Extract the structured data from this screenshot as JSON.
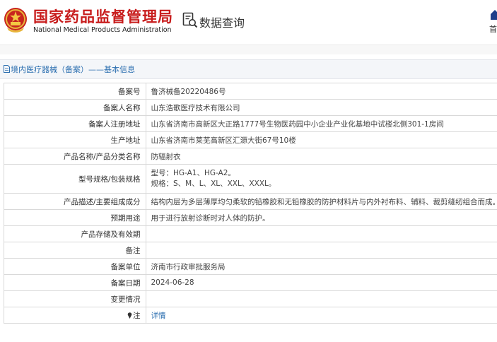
{
  "header": {
    "org_name_cn": "国家药品监督管理局",
    "org_name_en": "National Medical Products Administration",
    "query_label": "数据查询",
    "home_label": "首",
    "brand_color": "#c81d1d",
    "emblem_icon": "national-emblem-icon",
    "query_icon": "document-search-icon",
    "home_icon": "home-icon"
  },
  "breadcrumb": {
    "icon": "document-icon",
    "text": "境内医疗器械（备案）——基本信息"
  },
  "record": [
    {
      "label": "备案号",
      "value": "鲁济械备20220486号"
    },
    {
      "label": "备案人名称",
      "value": "山东浩歌医疗技术有限公司"
    },
    {
      "label": "备案人注册地址",
      "value": "山东省济南市高新区大正路1777号生物医药园中小企业产业化基地中试楼北侧301-1房间"
    },
    {
      "label": "生产地址",
      "value": "山东省济南市莱芜高新区汇源大街67号10楼"
    },
    {
      "label": "产品名称/产品分类名称",
      "value": "防辐射衣"
    },
    {
      "label": "型号规格/包装规格",
      "value_lines": [
        "型号：HG-A1、HG-A2。",
        "规格：S、M、L、XL、XXL、XXXL。"
      ]
    },
    {
      "label": "产品描述/主要组成成分",
      "value": "结构内层为多层薄厚均匀柔软的铅橡胶和无铅橡胶的防护材料片与内外衬布料、辅料、裁剪缝纫组合而成。"
    },
    {
      "label": "预期用途",
      "value": "用于进行放射诊断时对人体的防护。"
    },
    {
      "label": "产品存储及有效期",
      "value": ""
    },
    {
      "label": "备注",
      "value": ""
    },
    {
      "label": "备案单位",
      "value": "济南市行政审批服务局"
    },
    {
      "label": "备案日期",
      "value": "2024-06-28"
    },
    {
      "label": "变更情况",
      "value": ""
    },
    {
      "label": "注",
      "label_icon": "pin-icon",
      "link": "详情",
      "link_color": "#2c6fb0"
    }
  ]
}
